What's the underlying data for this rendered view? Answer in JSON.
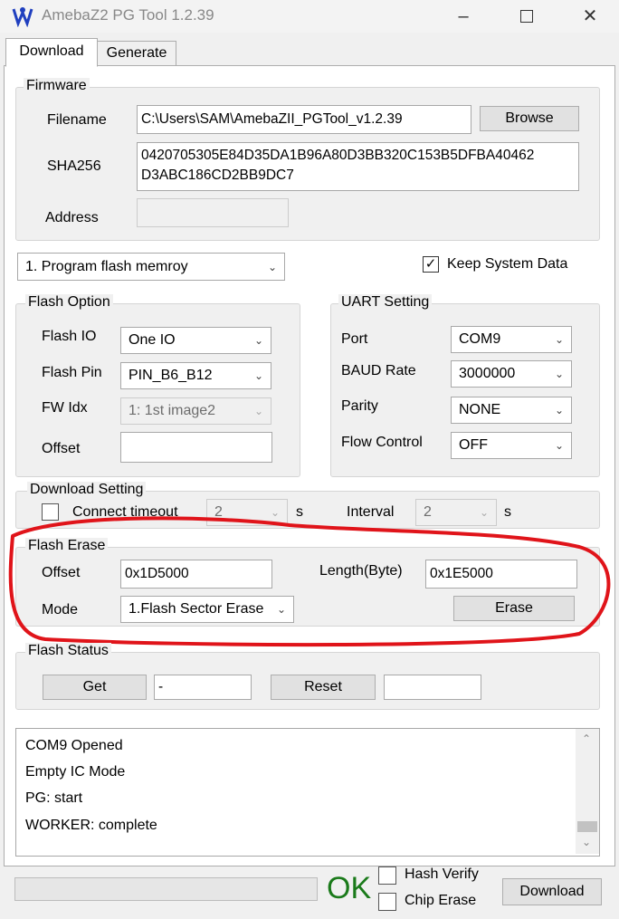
{
  "window": {
    "title": "AmebaZ2 PG Tool 1.2.39"
  },
  "tabs": [
    {
      "label": "Download"
    },
    {
      "label": "Generate"
    }
  ],
  "firmware": {
    "group_label": "Firmware",
    "filename_label": "Filename",
    "filename_value": "C:\\Users\\SAM\\AmebaZII_PGTool_v1.2.39",
    "browse_label": "Browse",
    "sha_label": "SHA256",
    "sha_line1": "0420705305E84D35DA1B96A80D3BB320C153B5DFBA40462",
    "sha_line2": "D3ABC186CD2BB9DC7",
    "address_label": "Address",
    "address_value": ""
  },
  "mode_select": {
    "value": "1. Program flash memroy"
  },
  "keep_system_data": {
    "label": "Keep System Data",
    "checked": true
  },
  "flash_option": {
    "group_label": "Flash Option",
    "io_label": "Flash IO",
    "io_value": "One IO",
    "pin_label": "Flash Pin",
    "pin_value": "PIN_B6_B12",
    "fwidx_label": "FW Idx",
    "fwidx_value": "1: 1st image2",
    "offset_label": "Offset",
    "offset_value": ""
  },
  "uart": {
    "group_label": "UART Setting",
    "port_label": "Port",
    "port_value": "COM9",
    "baud_label": "BAUD Rate",
    "baud_value": "3000000",
    "parity_label": "Parity",
    "parity_value": "NONE",
    "flow_label": "Flow Control",
    "flow_value": "OFF"
  },
  "download_setting": {
    "group_label": "Download Setting",
    "connect_label": "Connect timeout",
    "connect_value": "2",
    "connect_unit": "s",
    "interval_label": "Interval",
    "interval_value": "2",
    "interval_unit": "s"
  },
  "flash_erase": {
    "group_label": "Flash Erase",
    "offset_label": "Offset",
    "offset_value": "0x1D5000",
    "length_label": "Length(Byte)",
    "length_value": "0x1E5000",
    "mode_label": "Mode",
    "mode_value": "1.Flash Sector Erase",
    "erase_label": "Erase"
  },
  "flash_status": {
    "group_label": "Flash Status",
    "get_label": "Get",
    "get_value": "-",
    "reset_label": "Reset",
    "reset_value": ""
  },
  "log": {
    "lines": [
      "COM9 Opened",
      "Empty IC Mode",
      "PG: start",
      "WORKER: complete"
    ]
  },
  "bottom": {
    "ok_label": "OK",
    "hash_verify_label": "Hash Verify",
    "chip_erase_label": "Chip Erase",
    "download_label": "Download"
  },
  "colors": {
    "annotation": "#e0141a",
    "ok_green": "#1a7a1a",
    "app_icon": "#1f3fbf"
  },
  "icons": {
    "app": "app-logo-icon",
    "minimize": "minimize-icon",
    "maximize": "maximize-icon",
    "close": "close-icon",
    "dropdown": "chevron-down-icon",
    "scroll_up": "scroll-up-icon",
    "scroll_down": "scroll-down-icon",
    "annotation": "red-circle-annotation"
  }
}
